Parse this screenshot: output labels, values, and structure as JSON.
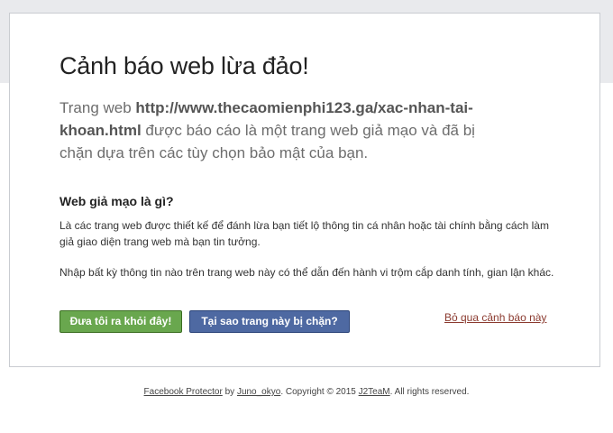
{
  "warning": {
    "title": "Cảnh báo web lừa đảo!",
    "lead_prefix": "Trang web ",
    "url": "http://www.thecaomienphi123.ga/xac-nhan-tai-khoan.html",
    "lead_suffix": " được báo cáo là một trang web giả mạo và đã bị chặn dựa trên các tùy chọn bảo mật của bạn."
  },
  "info": {
    "heading": "Web giả mạo là gì?",
    "paragraph_1": "Là các trang web được thiết kế để đánh lừa bạn tiết lộ thông tin cá nhân hoặc tài chính bằng cách làm giả giao diện trang web mà bạn tin tưởng.",
    "paragraph_2": "Nhập bất kỳ thông tin nào trên trang web này có thể dẫn đến hành vi trộm cắp danh tính, gian lận khác."
  },
  "actions": {
    "leave_button": "Đưa tôi ra khỏi đây!",
    "why_button": "Tại sao trang này bị chặn?",
    "ignore_link": "Bỏ qua cảnh báo này"
  },
  "footer": {
    "product_link": "Facebook Protector",
    "by_text": " by ",
    "author_link": "Juno_okyo",
    "copyright_text": ". Copyright © 2015 ",
    "team_link": "J2TeaM",
    "rights_text": ". All rights reserved."
  },
  "colors": {
    "leave_button": "#69a74e",
    "why_button": "#4e69a2",
    "ignore_link": "#8b3a2f",
    "background_band": "#e9eaed"
  }
}
